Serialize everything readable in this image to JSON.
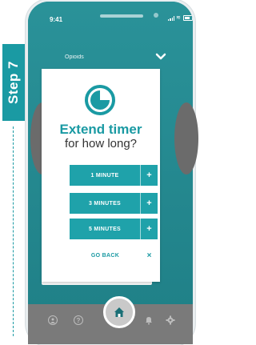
{
  "step": {
    "label": "Step 7"
  },
  "status_bar": {
    "time": "9:41"
  },
  "header": {
    "title": "Opioids"
  },
  "modal": {
    "title": "Extend timer",
    "subtitle": "for how long?",
    "options": [
      {
        "label": "1 MINUTE"
      },
      {
        "label": "3 MINUTES"
      },
      {
        "label": "5 MINUTES"
      }
    ],
    "plus_symbol": "+",
    "go_back": {
      "label": "GO BACK",
      "close_symbol": "×"
    }
  },
  "tabbar": {
    "help_symbol": "?",
    "icons": [
      "profile-icon",
      "help-icon",
      "home-icon",
      "bell-icon",
      "settings-icon"
    ]
  },
  "colors": {
    "accent": "#1a9aa3",
    "button": "#1fa2aa",
    "screen_bg": "#27878e",
    "tabbar_bg": "#7a7a7a"
  }
}
